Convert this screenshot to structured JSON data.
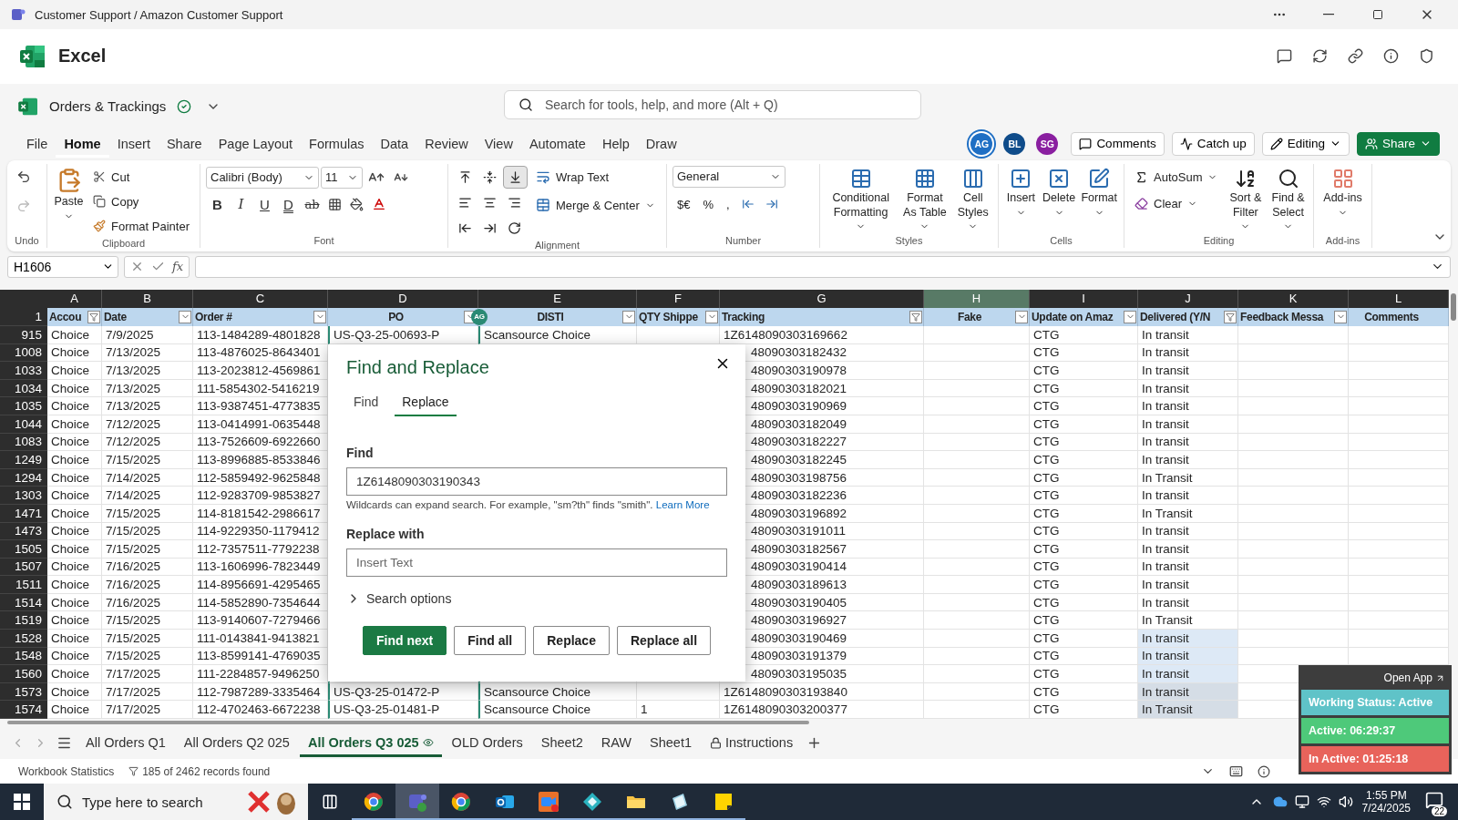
{
  "window": {
    "title": "Customer Support / Amazon Customer Support"
  },
  "app": {
    "name": "Excel"
  },
  "file": {
    "name": "Orders & Trackings",
    "search_placeholder": "Search for tools, help, and more (Alt + Q)"
  },
  "menu": [
    {
      "label": "File",
      "selected": false
    },
    {
      "label": "Home",
      "selected": true
    },
    {
      "label": "Insert",
      "selected": false
    },
    {
      "label": "Share",
      "selected": false
    },
    {
      "label": "Page Layout",
      "selected": false
    },
    {
      "label": "Formulas",
      "selected": false
    },
    {
      "label": "Data",
      "selected": false
    },
    {
      "label": "Review",
      "selected": false
    },
    {
      "label": "View",
      "selected": false
    },
    {
      "label": "Automate",
      "selected": false
    },
    {
      "label": "Help",
      "selected": false
    },
    {
      "label": "Draw",
      "selected": false
    }
  ],
  "collaborators": [
    {
      "initials": "AG",
      "color": "#1f6fc4",
      "selected": true
    },
    {
      "initials": "BL",
      "color": "#0f4c8a",
      "selected": false
    },
    {
      "initials": "SG",
      "color": "#8a1fa0",
      "selected": false
    }
  ],
  "header_buttons": [
    "Comments",
    "Catch up",
    "Editing",
    "Share"
  ],
  "ribbon": {
    "groups": [
      {
        "label": "Undo",
        "kind": "undo"
      },
      {
        "label": "Clipboard",
        "kind": "clipboard",
        "paste": "Paste",
        "items": [
          "Cut",
          "Copy",
          "Format Painter"
        ]
      },
      {
        "label": "Font",
        "kind": "font",
        "font": "Calibri (Body)",
        "size": "11",
        "buttons": [
          {
            "label": "B",
            "kind": "bold"
          },
          {
            "label": "I",
            "kind": "italic"
          },
          {
            "label": "U",
            "kind": "underline"
          },
          {
            "label": "D",
            "kind": "double"
          },
          {
            "label": "ab",
            "kind": "strike"
          }
        ]
      },
      {
        "label": "Alignment",
        "kind": "alignment",
        "valign": [
          {
            "selected": false
          },
          {
            "selected": false
          },
          {
            "selected": true
          }
        ],
        "items": [
          "Wrap Text",
          "Merge & Center"
        ]
      },
      {
        "label": "Number",
        "kind": "number",
        "format": "General",
        "buttons": [
          "$€",
          "%",
          ","
        ]
      },
      {
        "label": "Styles",
        "kind": "large",
        "items": [
          "Conditional Formatting",
          "Format As Table",
          "Cell Styles"
        ]
      },
      {
        "label": "Cells",
        "kind": "large",
        "items": [
          "Insert",
          "Delete",
          "Format"
        ]
      },
      {
        "label": "Editing",
        "kind": "editing",
        "items": [
          "AutoSum",
          "Clear"
        ],
        "large": [
          "Sort & Filter",
          "Find & Select"
        ]
      },
      {
        "label": "Add-ins",
        "kind": "large",
        "items": [
          "Add-ins"
        ]
      }
    ]
  },
  "formula_bar": {
    "cell": "H1606",
    "function_label": "fx"
  },
  "sheet": {
    "columns": [
      {
        "letter": "A",
        "selected": false
      },
      {
        "letter": "B",
        "selected": false
      },
      {
        "letter": "C",
        "selected": false
      },
      {
        "letter": "D",
        "selected": false
      },
      {
        "letter": "E",
        "selected": false
      },
      {
        "letter": "F",
        "selected": false
      },
      {
        "letter": "G",
        "selected": false
      },
      {
        "letter": "H",
        "selected": true
      },
      {
        "letter": "I",
        "selected": false
      },
      {
        "letter": "J",
        "selected": false
      },
      {
        "letter": "K",
        "selected": false
      },
      {
        "letter": "L",
        "selected": false
      }
    ],
    "header_row": "1",
    "headers": [
      {
        "label": "Accou",
        "filtered": true
      },
      {
        "label": "Date",
        "filtered": false
      },
      {
        "label": "Order #",
        "filtered": false
      },
      {
        "label": "PO",
        "filtered": false,
        "presence": "AG"
      },
      {
        "label": "DISTI",
        "filtered": false
      },
      {
        "label": "QTY Shippe",
        "filtered": false
      },
      {
        "label": "Tracking",
        "filtered": true
      },
      {
        "label": "Fake",
        "filtered": false
      },
      {
        "label": "Update on Amaz",
        "filtered": false
      },
      {
        "label": "Delivered (Y/N",
        "filtered": true
      },
      {
        "label": "Feedback Messa",
        "filtered": false
      },
      {
        "label": "Comments"
      }
    ],
    "rows": [
      {
        "row": "915",
        "account": "Choice",
        "date": "7/9/2025",
        "order": "113-1484289-4801828",
        "po": "US-Q3-25-00693-P",
        "disti": "Scansource Choice",
        "tracking": "1Z6148090303169662",
        "update": "CTG",
        "delivered": "In transit",
        "selected": false
      },
      {
        "row": "1008",
        "account": "Choice",
        "date": "7/13/2025",
        "order": "113-4876025-8643401",
        "tracking": "48090303182432",
        "update": "CTG",
        "delivered": "In transit",
        "selected": false
      },
      {
        "row": "1033",
        "account": "Choice",
        "date": "7/13/2025",
        "order": "113-2023812-4569861",
        "tracking": "48090303190978",
        "update": "CTG",
        "delivered": "In transit",
        "selected": false
      },
      {
        "row": "1034",
        "account": "Choice",
        "date": "7/13/2025",
        "order": "111-5854302-5416219",
        "tracking": "48090303182021",
        "update": "CTG",
        "delivered": "In transit",
        "selected": false
      },
      {
        "row": "1035",
        "account": "Choice",
        "date": "7/13/2025",
        "order": "113-9387451-4773835",
        "tracking": "48090303190969",
        "update": "CTG",
        "delivered": "In transit",
        "selected": false
      },
      {
        "row": "1044",
        "account": "Choice",
        "date": "7/12/2025",
        "order": "113-0414991-0635448",
        "tracking": "48090303182049",
        "update": "CTG",
        "delivered": "In transit",
        "selected": false
      },
      {
        "row": "1083",
        "account": "Choice",
        "date": "7/12/2025",
        "order": "113-7526609-6922660",
        "tracking": "48090303182227",
        "update": "CTG",
        "delivered": "In transit",
        "selected": false
      },
      {
        "row": "1249",
        "account": "Choice",
        "date": "7/15/2025",
        "order": "113-8996885-8533846",
        "tracking": "48090303182245",
        "update": "CTG",
        "delivered": "In transit",
        "selected": false
      },
      {
        "row": "1294",
        "account": "Choice",
        "date": "7/14/2025",
        "order": "112-5859492-9625848",
        "tracking": "48090303198756",
        "update": "CTG",
        "delivered": "In Transit",
        "selected": false
      },
      {
        "row": "1303",
        "account": "Choice",
        "date": "7/14/2025",
        "order": "112-9283709-9853827",
        "tracking": "48090303182236",
        "update": "CTG",
        "delivered": "In transit",
        "selected": false
      },
      {
        "row": "1471",
        "account": "Choice",
        "date": "7/15/2025",
        "order": "114-8181542-2986617",
        "tracking": "48090303196892",
        "update": "CTG",
        "delivered": "In Transit",
        "selected": false
      },
      {
        "row": "1473",
        "account": "Choice",
        "date": "7/15/2025",
        "order": "114-9229350-1179412",
        "tracking": "48090303191011",
        "update": "CTG",
        "delivered": "In transit",
        "selected": false
      },
      {
        "row": "1505",
        "account": "Choice",
        "date": "7/15/2025",
        "order": "112-7357511-7792238",
        "tracking": "48090303182567",
        "update": "CTG",
        "delivered": "In transit",
        "selected": false
      },
      {
        "row": "1507",
        "account": "Choice",
        "date": "7/16/2025",
        "order": "113-1606996-7823449",
        "tracking": "48090303190414",
        "update": "CTG",
        "delivered": "In transit",
        "selected": false
      },
      {
        "row": "1511",
        "account": "Choice",
        "date": "7/16/2025",
        "order": "114-8956691-4295465",
        "tracking": "48090303189613",
        "update": "CTG",
        "delivered": "In transit",
        "selected": false
      },
      {
        "row": "1514",
        "account": "Choice",
        "date": "7/16/2025",
        "order": "114-5852890-7354644",
        "tracking": "48090303190405",
        "update": "CTG",
        "delivered": "In transit",
        "selected": false
      },
      {
        "row": "1519",
        "account": "Choice",
        "date": "7/15/2025",
        "order": "113-9140607-7279466",
        "tracking": "48090303196927",
        "update": "CTG",
        "delivered": "In Transit",
        "selected": false
      },
      {
        "row": "1528",
        "account": "Choice",
        "date": "7/15/2025",
        "order": "111-0143841-9413821",
        "tracking": "48090303190469",
        "update": "CTG",
        "delivered": "In transit",
        "selected": true
      },
      {
        "row": "1548",
        "account": "Choice",
        "date": "7/15/2025",
        "order": "113-8599141-4769035",
        "tracking": "48090303191379",
        "update": "CTG",
        "delivered": "In transit",
        "selected": true
      },
      {
        "row": "1560",
        "account": "Choice",
        "date": "7/17/2025",
        "order": "111-2284857-9496250",
        "tracking": "48090303195035",
        "update": "CTG",
        "delivered": "In transit",
        "selected": true
      },
      {
        "row": "1573",
        "account": "Choice",
        "date": "7/17/2025",
        "order": "112-7987289-3335464",
        "po": "US-Q3-25-01472-P",
        "disti": "Scansource Choice",
        "tracking": "1Z6148090303193840",
        "update": "CTG",
        "delivered": "In transit",
        "selected": true
      },
      {
        "row": "1574",
        "account": "Choice",
        "date": "7/17/2025",
        "order": "112-4702463-6672238",
        "po": "US-Q3-25-01481-P",
        "disti": "Scansource Choice",
        "qty": "1",
        "tracking": "1Z6148090303200377",
        "update": "CTG",
        "delivered": "In Transit",
        "selected": true
      }
    ]
  },
  "dialog": {
    "title": "Find and Replace",
    "tabs": [
      {
        "label": "Find",
        "selected": false
      },
      {
        "label": "Replace",
        "selected": true
      }
    ],
    "find_label": "Find",
    "find_value": "1Z6148090303190343",
    "hint": "Wildcards can expand search. For example, \"sm?th\" finds \"smith\".",
    "hint_link": "Learn More",
    "replace_label": "Replace with",
    "replace_placeholder": "Insert Text",
    "options": {
      "label": "Search options",
      "expanded": false
    },
    "buttons": [
      {
        "label": "Find next",
        "primary": true
      },
      {
        "label": "Find all",
        "primary": false
      },
      {
        "label": "Replace",
        "primary": false
      },
      {
        "label": "Replace all",
        "primary": false
      }
    ]
  },
  "sheet_tabs": [
    {
      "label": "All Orders Q1",
      "selected": false
    },
    {
      "label": "All Orders Q2 025",
      "selected": false
    },
    {
      "label": "All Orders Q3 025",
      "selected": true
    },
    {
      "label": "OLD Orders",
      "selected": false
    },
    {
      "label": "Sheet2",
      "selected": false
    },
    {
      "label": "RAW",
      "selected": false
    },
    {
      "label": "Sheet1",
      "selected": false
    },
    {
      "label": "Instructions",
      "selected": false,
      "locked": true
    }
  ],
  "status_bar": {
    "stats": "Workbook Statistics",
    "records": "185 of 2462 records found"
  },
  "tracker": {
    "open": "Open App",
    "status": "Working Status: Active",
    "active": "Active: 06:29:37",
    "inactive": "In Active: 01:25:18"
  },
  "taskbar": {
    "search_placeholder": "Type here to search",
    "apps": [
      {
        "selected": false
      },
      {
        "selected": true
      },
      {
        "selected": false
      },
      {
        "selected": false
      },
      {
        "selected": false
      },
      {
        "selected": false
      },
      {
        "selected": false
      },
      {
        "selected": false
      },
      {
        "selected": false
      }
    ],
    "time": "1:55 PM",
    "date": "7/24/2025",
    "notifications": "22"
  }
}
